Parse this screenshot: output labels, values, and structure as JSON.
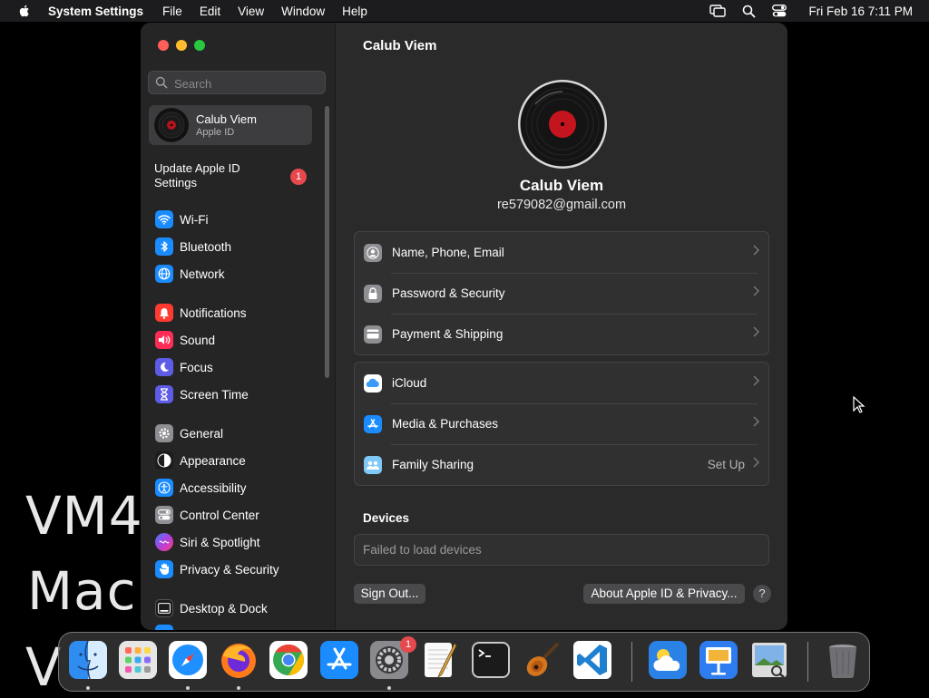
{
  "menubar": {
    "apple_icon": "apple-logo-icon",
    "app_name": "System Settings",
    "menus": [
      "File",
      "Edit",
      "View",
      "Window",
      "Help"
    ],
    "status_icons": [
      "screen-mirroring-icon",
      "spotlight-search-icon",
      "control-center-icon"
    ],
    "clock": "Fri Feb 16  7:11 PM"
  },
  "wallpaper": {
    "lines": [
      "VM4",
      "Mac(",
      "V"
    ]
  },
  "sidebar": {
    "search_placeholder": "Search",
    "account": {
      "name": "Calub Viem",
      "subtitle": "Apple ID"
    },
    "update": {
      "label": "Update Apple ID Settings",
      "badge": "1"
    },
    "groups": [
      [
        {
          "label": "Wi-Fi",
          "icon": "wifi-icon",
          "color": "#1a8cff"
        },
        {
          "label": "Bluetooth",
          "icon": "bluetooth-icon",
          "color": "#1a8cff"
        },
        {
          "label": "Network",
          "icon": "globe-icon",
          "color": "#1a8cff"
        }
      ],
      [
        {
          "label": "Notifications",
          "icon": "bell-icon",
          "color": "#ff3b30"
        },
        {
          "label": "Sound",
          "icon": "speaker-icon",
          "color": "#ff2d55"
        },
        {
          "label": "Focus",
          "icon": "moon-icon",
          "color": "#5e5ce6"
        },
        {
          "label": "Screen Time",
          "icon": "hourglass-icon",
          "color": "#5e5ce6"
        }
      ],
      [
        {
          "label": "General",
          "icon": "gear-icon",
          "color": "#8e8e93"
        },
        {
          "label": "Appearance",
          "icon": "appearance-icon",
          "color": "#1c1c1e"
        },
        {
          "label": "Accessibility",
          "icon": "accessibility-icon",
          "color": "#1a8cff"
        },
        {
          "label": "Control Center",
          "icon": "control-center-icon",
          "color": "#8e8e93"
        },
        {
          "label": "Siri & Spotlight",
          "icon": "siri-icon",
          "color": "#b040e0"
        },
        {
          "label": "Privacy & Security",
          "icon": "hand-icon",
          "color": "#1a8cff"
        }
      ],
      [
        {
          "label": "Desktop & Dock",
          "icon": "dock-icon",
          "color": "#1c1c1e"
        }
      ]
    ]
  },
  "content": {
    "title": "Calub Viem",
    "profile_name": "Calub Viem",
    "profile_email": "re579082@gmail.com",
    "group1": [
      {
        "label": "Name, Phone, Email",
        "icon": "contact-icon",
        "color": "#8e8e93"
      },
      {
        "label": "Password & Security",
        "icon": "lock-icon",
        "color": "#8e8e93"
      },
      {
        "label": "Payment & Shipping",
        "icon": "credit-card-icon",
        "color": "#8e8e93"
      }
    ],
    "group2": [
      {
        "label": "iCloud",
        "icon": "icloud-icon",
        "color": "#ffffff",
        "value": ""
      },
      {
        "label": "Media & Purchases",
        "icon": "app-store-icon",
        "color": "#1a8cff",
        "value": ""
      },
      {
        "label": "Family Sharing",
        "icon": "family-sharing-icon",
        "color": "#7fc8f8",
        "value": "Set Up"
      }
    ],
    "devices_label": "Devices",
    "devices_status": "Failed to load devices",
    "sign_out": "Sign Out...",
    "about": "About Apple ID & Privacy...",
    "help": "?"
  },
  "dock": {
    "apps": [
      {
        "name": "Finder",
        "icon": "finder-icon"
      },
      {
        "name": "Launchpad",
        "icon": "launchpad-icon"
      },
      {
        "name": "Safari",
        "icon": "safari-icon"
      },
      {
        "name": "Firefox",
        "icon": "firefox-icon"
      },
      {
        "name": "Chrome",
        "icon": "chrome-icon"
      },
      {
        "name": "App Store",
        "icon": "app-store-icon"
      },
      {
        "name": "System Settings",
        "icon": "system-settings-icon",
        "badge": "1"
      },
      {
        "name": "TextEdit",
        "icon": "textedit-icon"
      },
      {
        "name": "Terminal",
        "icon": "terminal-icon"
      },
      {
        "name": "GarageBand",
        "icon": "garageband-icon"
      },
      {
        "name": "Visual Studio Code",
        "icon": "vscode-icon"
      },
      {
        "name": "Weather",
        "icon": "weather-icon"
      },
      {
        "name": "Keynote",
        "icon": "keynote-icon"
      },
      {
        "name": "Preview",
        "icon": "preview-icon"
      },
      {
        "name": "Trash",
        "icon": "trash-icon"
      }
    ]
  }
}
